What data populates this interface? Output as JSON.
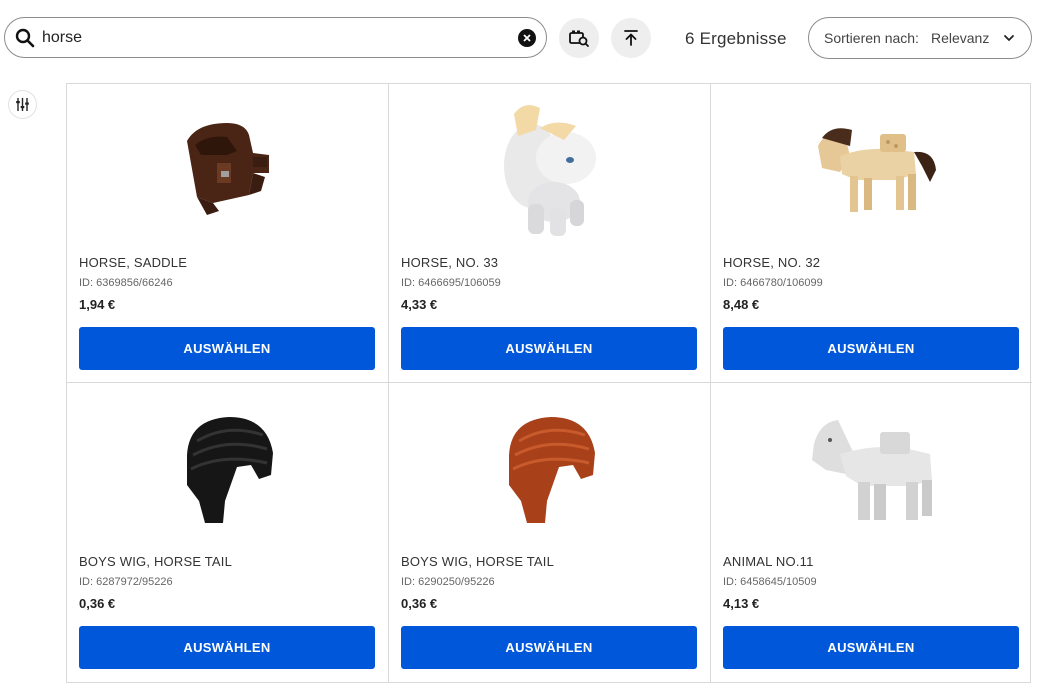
{
  "search": {
    "value": "horse",
    "placeholder": ""
  },
  "results_label": "6 Ergebnisse",
  "sort": {
    "label": "Sortieren nach:",
    "value": "Relevanz"
  },
  "colors": {
    "accent": "#0057d9",
    "border": "#d9d9d9"
  },
  "products": [
    {
      "name": "HORSE, SADDLE",
      "id": "ID: 6369856/66246",
      "price": "1,94 €",
      "button": "AUSWÄHLEN",
      "icon": "saddle-image"
    },
    {
      "name": "HORSE, NO. 33",
      "id": "ID: 6466695/106059",
      "price": "4,33 €",
      "button": "AUSWÄHLEN",
      "icon": "white-pony-image"
    },
    {
      "name": "HORSE, NO. 32",
      "id": "ID: 6466780/106099",
      "price": "8,48 €",
      "button": "AUSWÄHLEN",
      "icon": "tan-horse-image"
    },
    {
      "name": "BOYS WIG, HORSE TAIL",
      "id": "ID: 6287972/95226",
      "price": "0,36 €",
      "button": "AUSWÄHLEN",
      "icon": "black-wig-image"
    },
    {
      "name": "BOYS WIG, HORSE TAIL",
      "id": "ID: 6290250/95226",
      "price": "0,36 €",
      "button": "AUSWÄHLEN",
      "icon": "brown-wig-image"
    },
    {
      "name": "ANIMAL NO.11",
      "id": "ID: 6458645/10509",
      "price": "4,13 €",
      "button": "AUSWÄHLEN",
      "icon": "grey-horse-image"
    }
  ]
}
